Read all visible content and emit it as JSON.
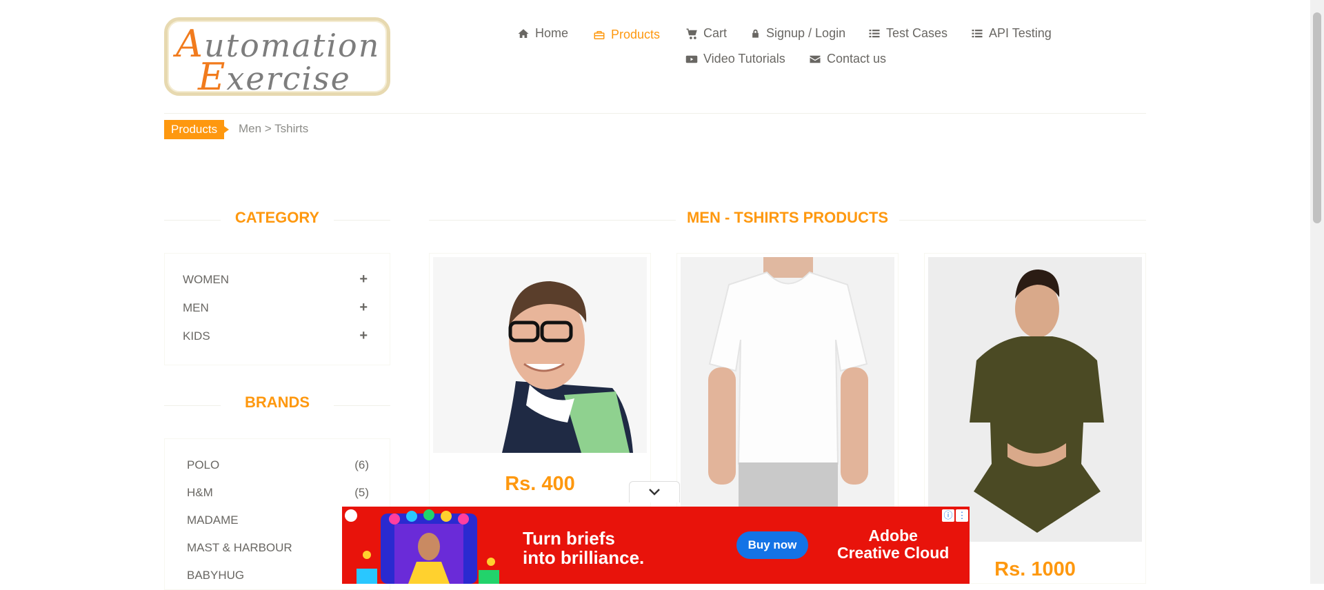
{
  "logo": {
    "line1_cap": "A",
    "line1_rest": "utomation",
    "line2_cap": "E",
    "line2_rest": "xercise"
  },
  "nav": [
    {
      "label": "Home",
      "icon": "home-icon"
    },
    {
      "label": "Products",
      "icon": "briefcase-icon",
      "active": true
    },
    {
      "label": "Cart",
      "icon": "cart-icon"
    },
    {
      "label": "Signup / Login",
      "icon": "lock-icon"
    },
    {
      "label": "Test Cases",
      "icon": "list-icon"
    },
    {
      "label": "API Testing",
      "icon": "list-icon"
    },
    {
      "label": "Video Tutorials",
      "icon": "youtube-icon"
    },
    {
      "label": "Contact us",
      "icon": "envelope-icon"
    }
  ],
  "breadcrumb": {
    "current": "Products",
    "path": "Men > Tshirts"
  },
  "sidebar": {
    "category_title": "CATEGORY",
    "categories": [
      {
        "label": "WOMEN"
      },
      {
        "label": "MEN"
      },
      {
        "label": "KIDS"
      }
    ],
    "brands_title": "BRANDS",
    "brands": [
      {
        "name": "POLO",
        "count": "(6)"
      },
      {
        "name": "H&M",
        "count": "(5)"
      },
      {
        "name": "MADAME",
        "count": ""
      },
      {
        "name": "MAST & HARBOUR",
        "count": ""
      },
      {
        "name": "BABYHUG",
        "count": ""
      }
    ]
  },
  "main": {
    "title": "MEN - TSHIRTS PRODUCTS",
    "products": [
      {
        "price": "Rs. 400",
        "image": "man-polo-photo"
      },
      {
        "price": "",
        "image": "white-tshirt-photo"
      },
      {
        "price": "Rs. 1000",
        "image": "olive-shirt-photo"
      }
    ]
  },
  "ad": {
    "headline_1": "Turn briefs",
    "headline_2": "into brilliance.",
    "cta": "Buy now",
    "brand_1": "Adobe",
    "brand_2": "Creative Cloud"
  },
  "colors": {
    "accent": "#fe980f",
    "ad_bg": "#e8130b",
    "ad_button": "#1473e6"
  }
}
